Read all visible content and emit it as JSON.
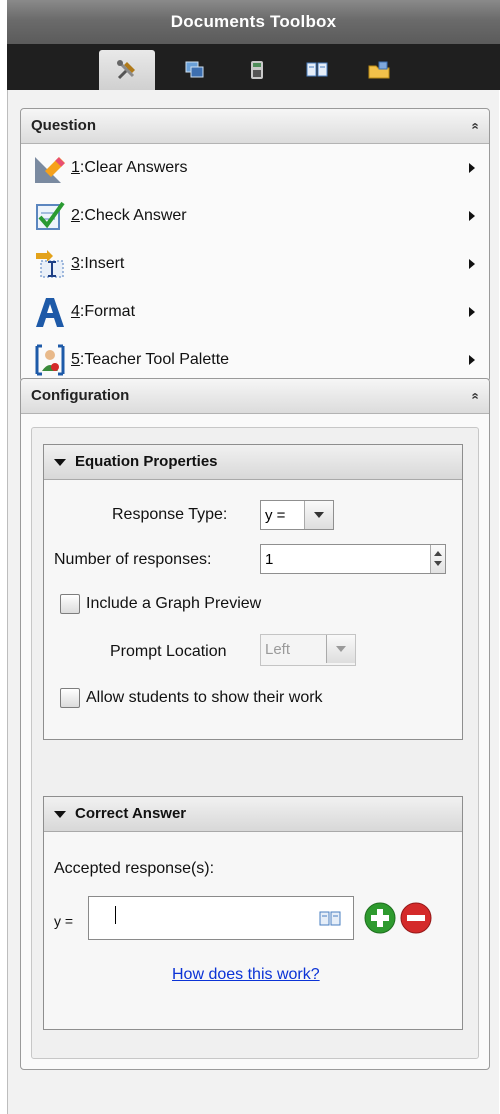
{
  "window": {
    "title": "Documents Toolbox"
  },
  "tabs": [
    {
      "icon": "tools-icon",
      "active": true
    },
    {
      "icon": "page-sorter-icon",
      "active": false
    },
    {
      "icon": "calculator-icon",
      "active": false
    },
    {
      "icon": "book-icon",
      "active": false
    },
    {
      "icon": "folder-icon",
      "active": false
    }
  ],
  "question": {
    "header": "Question",
    "collapse_glyph": "«",
    "items": [
      {
        "num": "1",
        "label": ":Clear Answers",
        "icon": "eraser-icon"
      },
      {
        "num": "2",
        "label": ":Check Answer",
        "icon": "check-answer-icon"
      },
      {
        "num": "3",
        "label": ":Insert",
        "icon": "insert-icon"
      },
      {
        "num": "4",
        "label": ":Format",
        "icon": "format-icon"
      },
      {
        "num": "5",
        "label": ":Teacher Tool Palette",
        "icon": "teacher-tool-icon"
      }
    ]
  },
  "configuration": {
    "header": "Configuration",
    "collapse_glyph": "«",
    "equation_properties": {
      "header": "Equation Properties",
      "response_type_label": "Response Type:",
      "response_type_value": "y =",
      "num_responses_label": "Number of responses:",
      "num_responses_value": "1",
      "graph_preview_label": "Include a Graph Preview",
      "graph_preview_checked": false,
      "prompt_location_label": "Prompt Location",
      "prompt_location_value": "Left",
      "show_work_label": "Allow students to show their work",
      "show_work_checked": false
    },
    "correct_answer": {
      "header": "Correct Answer",
      "accepted_label": "Accepted response(s):",
      "prefix": "y =",
      "help_link": "How does this work?"
    }
  },
  "colors": {
    "add": "#2e9a2e",
    "remove": "#d42a2a",
    "link": "#0b33d6"
  }
}
